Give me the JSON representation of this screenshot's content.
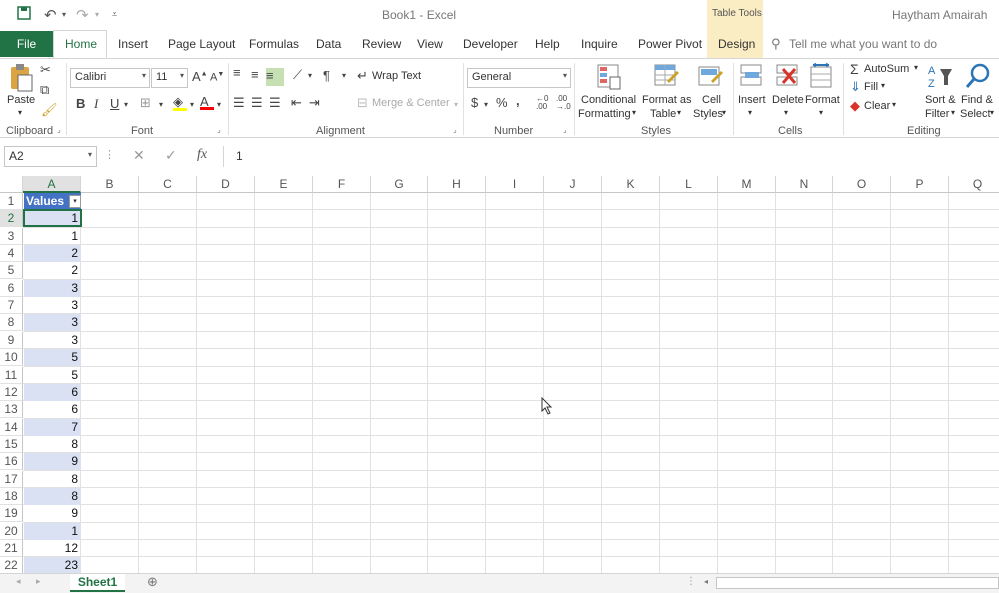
{
  "titlebar": {
    "doc_title": "Book1  -  Excel",
    "user": "Haytham Amairah",
    "contextual_group": "Table Tools"
  },
  "tabs": {
    "file": "File",
    "home": "Home",
    "insert": "Insert",
    "page_layout": "Page Layout",
    "formulas": "Formulas",
    "data": "Data",
    "review": "Review",
    "view": "View",
    "developer": "Developer",
    "help": "Help",
    "inquire": "Inquire",
    "power_pivot": "Power Pivot",
    "design": "Design",
    "tell_me": "Tell me what you want to do"
  },
  "ribbon": {
    "clipboard": {
      "paste": "Paste",
      "label": "Clipboard"
    },
    "font": {
      "name": "Calibri",
      "size": "11",
      "label": "Font"
    },
    "alignment": {
      "wrap_text": "Wrap Text",
      "merge_center": "Merge & Center",
      "label": "Alignment"
    },
    "number": {
      "format": "General",
      "label": "Number"
    },
    "styles": {
      "conditional_1": "Conditional",
      "conditional_2": "Formatting",
      "format_table_1": "Format as",
      "format_table_2": "Table",
      "cell_styles_1": "Cell",
      "cell_styles_2": "Styles",
      "label": "Styles"
    },
    "cells": {
      "insert": "Insert",
      "delete": "Delete",
      "format": "Format",
      "label": "Cells"
    },
    "editing": {
      "autosum": "AutoSum",
      "fill": "Fill",
      "clear": "Clear",
      "sort_1": "Sort &",
      "sort_2": "Filter",
      "find_1": "Find &",
      "find_2": "Select",
      "label": "Editing"
    }
  },
  "formula_bar": {
    "name_box": "A2",
    "value": "1"
  },
  "grid": {
    "columns": [
      "A",
      "B",
      "C",
      "D",
      "E",
      "F",
      "G",
      "H",
      "I",
      "J",
      "K",
      "L",
      "M",
      "N",
      "O",
      "P",
      "Q"
    ],
    "rows": [
      "1",
      "2",
      "3",
      "4",
      "5",
      "6",
      "7",
      "8",
      "9",
      "10",
      "11",
      "12",
      "13",
      "14",
      "15",
      "16",
      "17",
      "18",
      "19",
      "20",
      "21",
      "22"
    ],
    "header_cell": "Values",
    "values": [
      "1",
      "1",
      "2",
      "2",
      "3",
      "3",
      "3",
      "3",
      "5",
      "5",
      "6",
      "6",
      "7",
      "8",
      "9",
      "8",
      "8",
      "9",
      "1",
      "12",
      "23"
    ],
    "selected_cell": "A2"
  },
  "sheets": {
    "active": "Sheet1"
  },
  "colors": {
    "excel_green": "#217346",
    "table_header": "#4472c4",
    "table_band": "#d9e1f2"
  }
}
